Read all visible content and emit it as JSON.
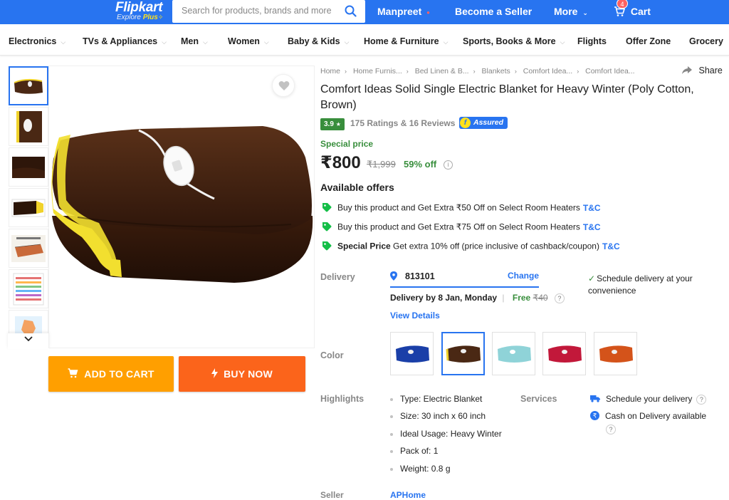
{
  "header": {
    "logo": "Flipkart",
    "logo_sub": "Explore",
    "logo_plus": "Plus",
    "search_placeholder": "Search for products, brands and more",
    "user": "Manpreet",
    "seller": "Become a Seller",
    "more": "More",
    "cart": "Cart",
    "cart_count": "4",
    "colors": {
      "brand": "#2874f0",
      "accent": "#ffe11b"
    }
  },
  "categories": [
    "Electronics",
    "TVs & Appliances",
    "Men",
    "Women",
    "Baby & Kids",
    "Home & Furniture",
    "Sports, Books & More",
    "Flights",
    "Offer Zone",
    "Grocery"
  ],
  "gallery": {
    "thumbnails": [
      "blanket-brown",
      "blanket-controller",
      "fabric-closeup",
      "blanket-folded-yellow-edge",
      "size-diagram",
      "heat-chart",
      "india-map"
    ],
    "active_thumbnail": 0
  },
  "actions": {
    "add_to_cart": "ADD TO CART",
    "buy_now": "BUY NOW"
  },
  "product": {
    "breadcrumbs": [
      "Home",
      "Home Furnis...",
      "Bed Linen & B...",
      "Blankets",
      "Comfort Idea...",
      "Comfort Idea..."
    ],
    "share": "Share",
    "title": "Comfort Ideas Solid Single Electric Blanket for Heavy Winter  (Poly Cotton, Brown)",
    "rating": "3.9",
    "rating_count": "175 Ratings & 16 Reviews",
    "assured": "Assured",
    "special_label": "Special price",
    "price": "₹800",
    "mrp": "₹1,999",
    "discount": "59% off"
  },
  "offers": {
    "heading": "Available offers",
    "items": [
      {
        "bold": "",
        "text": "Buy this product and Get Extra ₹50 Off on Select Room Heaters",
        "tnc": "T&C"
      },
      {
        "bold": "",
        "text": "Buy this product and Get Extra ₹75 Off on Select Room Heaters",
        "tnc": "T&C"
      },
      {
        "bold": "Special Price",
        "text": " Get extra 10% off (price inclusive of cashback/coupon)",
        "tnc": "T&C"
      }
    ]
  },
  "delivery": {
    "label": "Delivery",
    "pincode": "813101",
    "change": "Change",
    "date": "Delivery by 8 Jan, Monday",
    "sep": "|",
    "free": "Free",
    "fee": "₹40",
    "view_details": "View Details",
    "schedule": "Schedule delivery at your convenience"
  },
  "color": {
    "label": "Color",
    "swatches": [
      "#1a3fa8",
      "#4a2814",
      "#8fd3d8",
      "#c2183a",
      "#d4531a"
    ],
    "selected": 1
  },
  "highlights": {
    "label": "Highlights",
    "items": [
      "Type: Electric Blanket",
      "Size: 30 inch x 60 inch",
      "Ideal Usage: Heavy Winter",
      "Pack of: 1",
      "Weight: 0.8 g"
    ]
  },
  "services": {
    "label": "Services",
    "items": [
      "Schedule your delivery",
      "Cash on Delivery available"
    ]
  },
  "seller": {
    "label": "Seller",
    "name": "APHome"
  }
}
